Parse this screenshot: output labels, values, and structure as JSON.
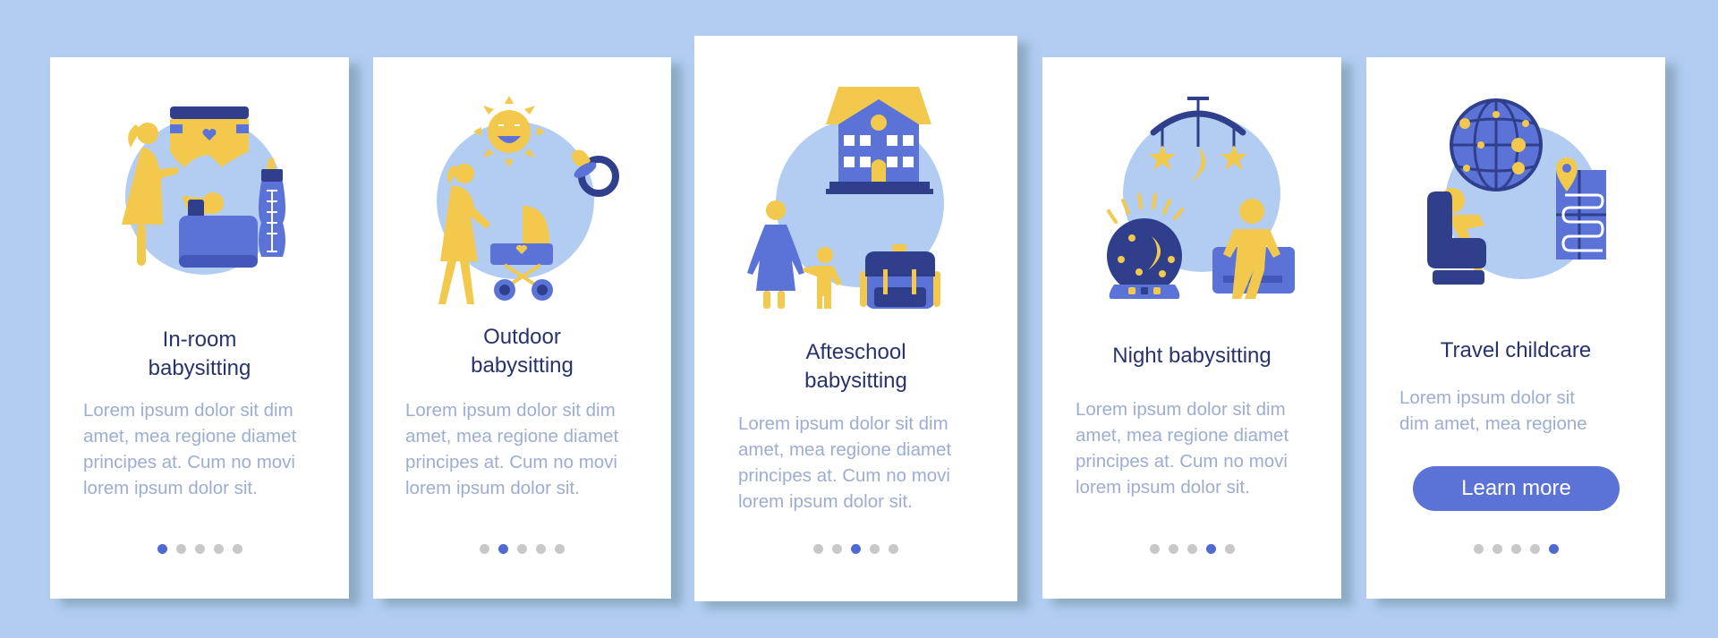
{
  "colors": {
    "background": "#b2cdf1",
    "card": "#ffffff",
    "title": "#27336b",
    "description": "#9dadd1",
    "accent": "#5b73d6",
    "dot_active": "#4f6ad2",
    "dot_inactive": "#c8c8c8",
    "yellow": "#f2c94c",
    "navy": "#2f3f8c",
    "circle": "#b2cdf1"
  },
  "cards": [
    {
      "title": "In-room\nbabysitting",
      "description": "Lorem ipsum dolor sit dim\namet, mea regione diamet\nprincipes at. Cum no movi\nlorem ipsum dolor sit.",
      "illustration": "in-room-babysitting-illustration",
      "active_page": 1,
      "page_count": 5
    },
    {
      "title": "Outdoor\nbabysitting",
      "description": "Lorem ipsum dolor sit dim\namet, mea regione diamet\nprincipes at. Cum no movi\nlorem ipsum dolor sit.",
      "illustration": "outdoor-babysitting-illustration",
      "active_page": 2,
      "page_count": 5
    },
    {
      "title": "Afteschool\nbabysitting",
      "description": "Lorem ipsum dolor sit dim\namet, mea regione diamet\nprincipes at. Cum no movi\nlorem ipsum dolor sit.",
      "illustration": "afterschool-babysitting-illustration",
      "active_page": 3,
      "page_count": 5
    },
    {
      "title": "Night babysitting",
      "description": "Lorem ipsum dolor sit dim\namet, mea regione diamet\nprincipes at. Cum no movi\nlorem ipsum dolor sit.",
      "illustration": "night-babysitting-illustration",
      "active_page": 4,
      "page_count": 5
    },
    {
      "title": "Travel childcare",
      "description": "Lorem ipsum dolor sit\ndim amet, mea regione",
      "illustration": "travel-childcare-illustration",
      "button_label": "Learn more",
      "active_page": 5,
      "page_count": 5
    }
  ]
}
